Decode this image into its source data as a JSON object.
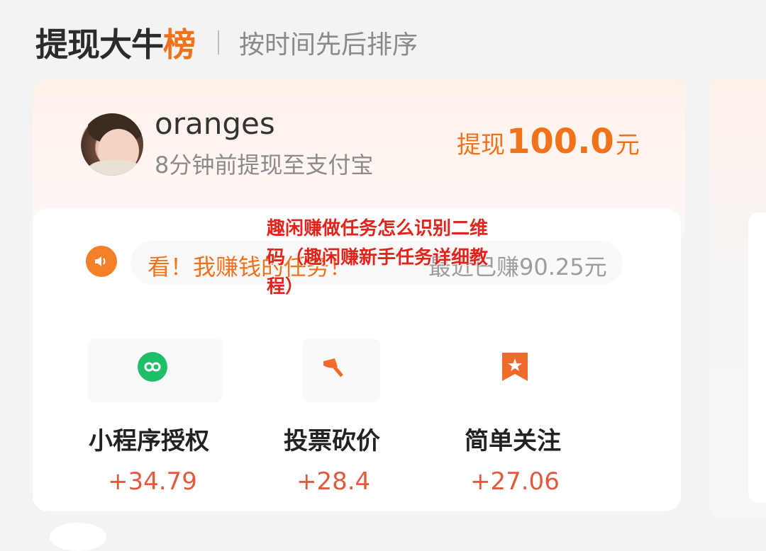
{
  "header": {
    "title_main": "提现大牛",
    "title_accent": "榜",
    "subtitle": "按时间先后排序"
  },
  "withdrawal": {
    "username": "oranges",
    "description": "8分钟前提现至支付宝",
    "prefix": "提现",
    "amount": "100.0",
    "suffix": "元"
  },
  "notice": {
    "left_text": "看！我赚钱的任务！",
    "right_text": "最近已赚90.25元"
  },
  "overlay_text": "趣闲赚做任务怎么识别二维码（趣闲赚新手任务详细教程）",
  "tasks": [
    {
      "label": "小程序授权",
      "reward": "+34.79",
      "icon": "mini-program-icon",
      "color": "#1fbf6a"
    },
    {
      "label": "投票砍价",
      "reward": "+28.4",
      "icon": "axe-icon",
      "color": "#f06a2a"
    },
    {
      "label": "简单关注",
      "reward": "+27.06",
      "icon": "star-bookmark-icon",
      "color": "#f06a2a"
    }
  ],
  "colors": {
    "accent": "#f0731c",
    "reward": "#e25a3c",
    "overlay": "#e1241c",
    "mini_program": "#1fbf6a"
  }
}
